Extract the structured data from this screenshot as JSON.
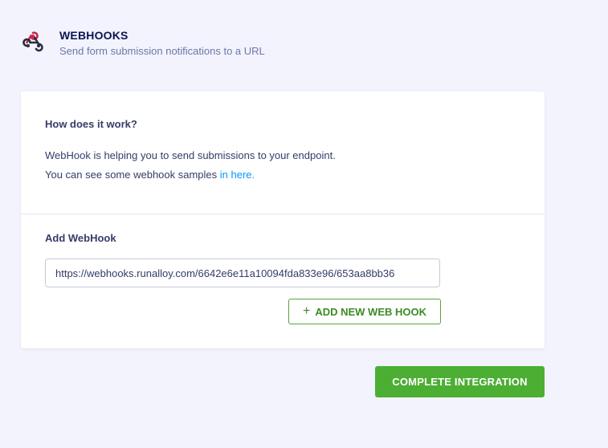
{
  "header": {
    "title": "WEBHOOKS",
    "subtitle": "Send form submission notifications to a URL",
    "icon": "webhook-icon"
  },
  "info": {
    "title": "How does it work?",
    "line1": "WebHook is helping you to send submissions to your endpoint.",
    "line2_prefix": "You can see some webhook samples ",
    "link_text": "in here."
  },
  "add_section": {
    "title": "Add WebHook",
    "input_value": "https://webhooks.runalloy.com/6642e6e11a10094fda833e96/653aa8bb36",
    "add_button_label": "ADD NEW WEB HOOK",
    "add_icon": "plus-icon"
  },
  "footer": {
    "complete_label": "COMPLETE INTEGRATION"
  },
  "colors": {
    "background": "#f3f3fe",
    "accent_green": "#4caf33",
    "link_blue": "#0099ff",
    "title_navy": "#0a1551"
  }
}
